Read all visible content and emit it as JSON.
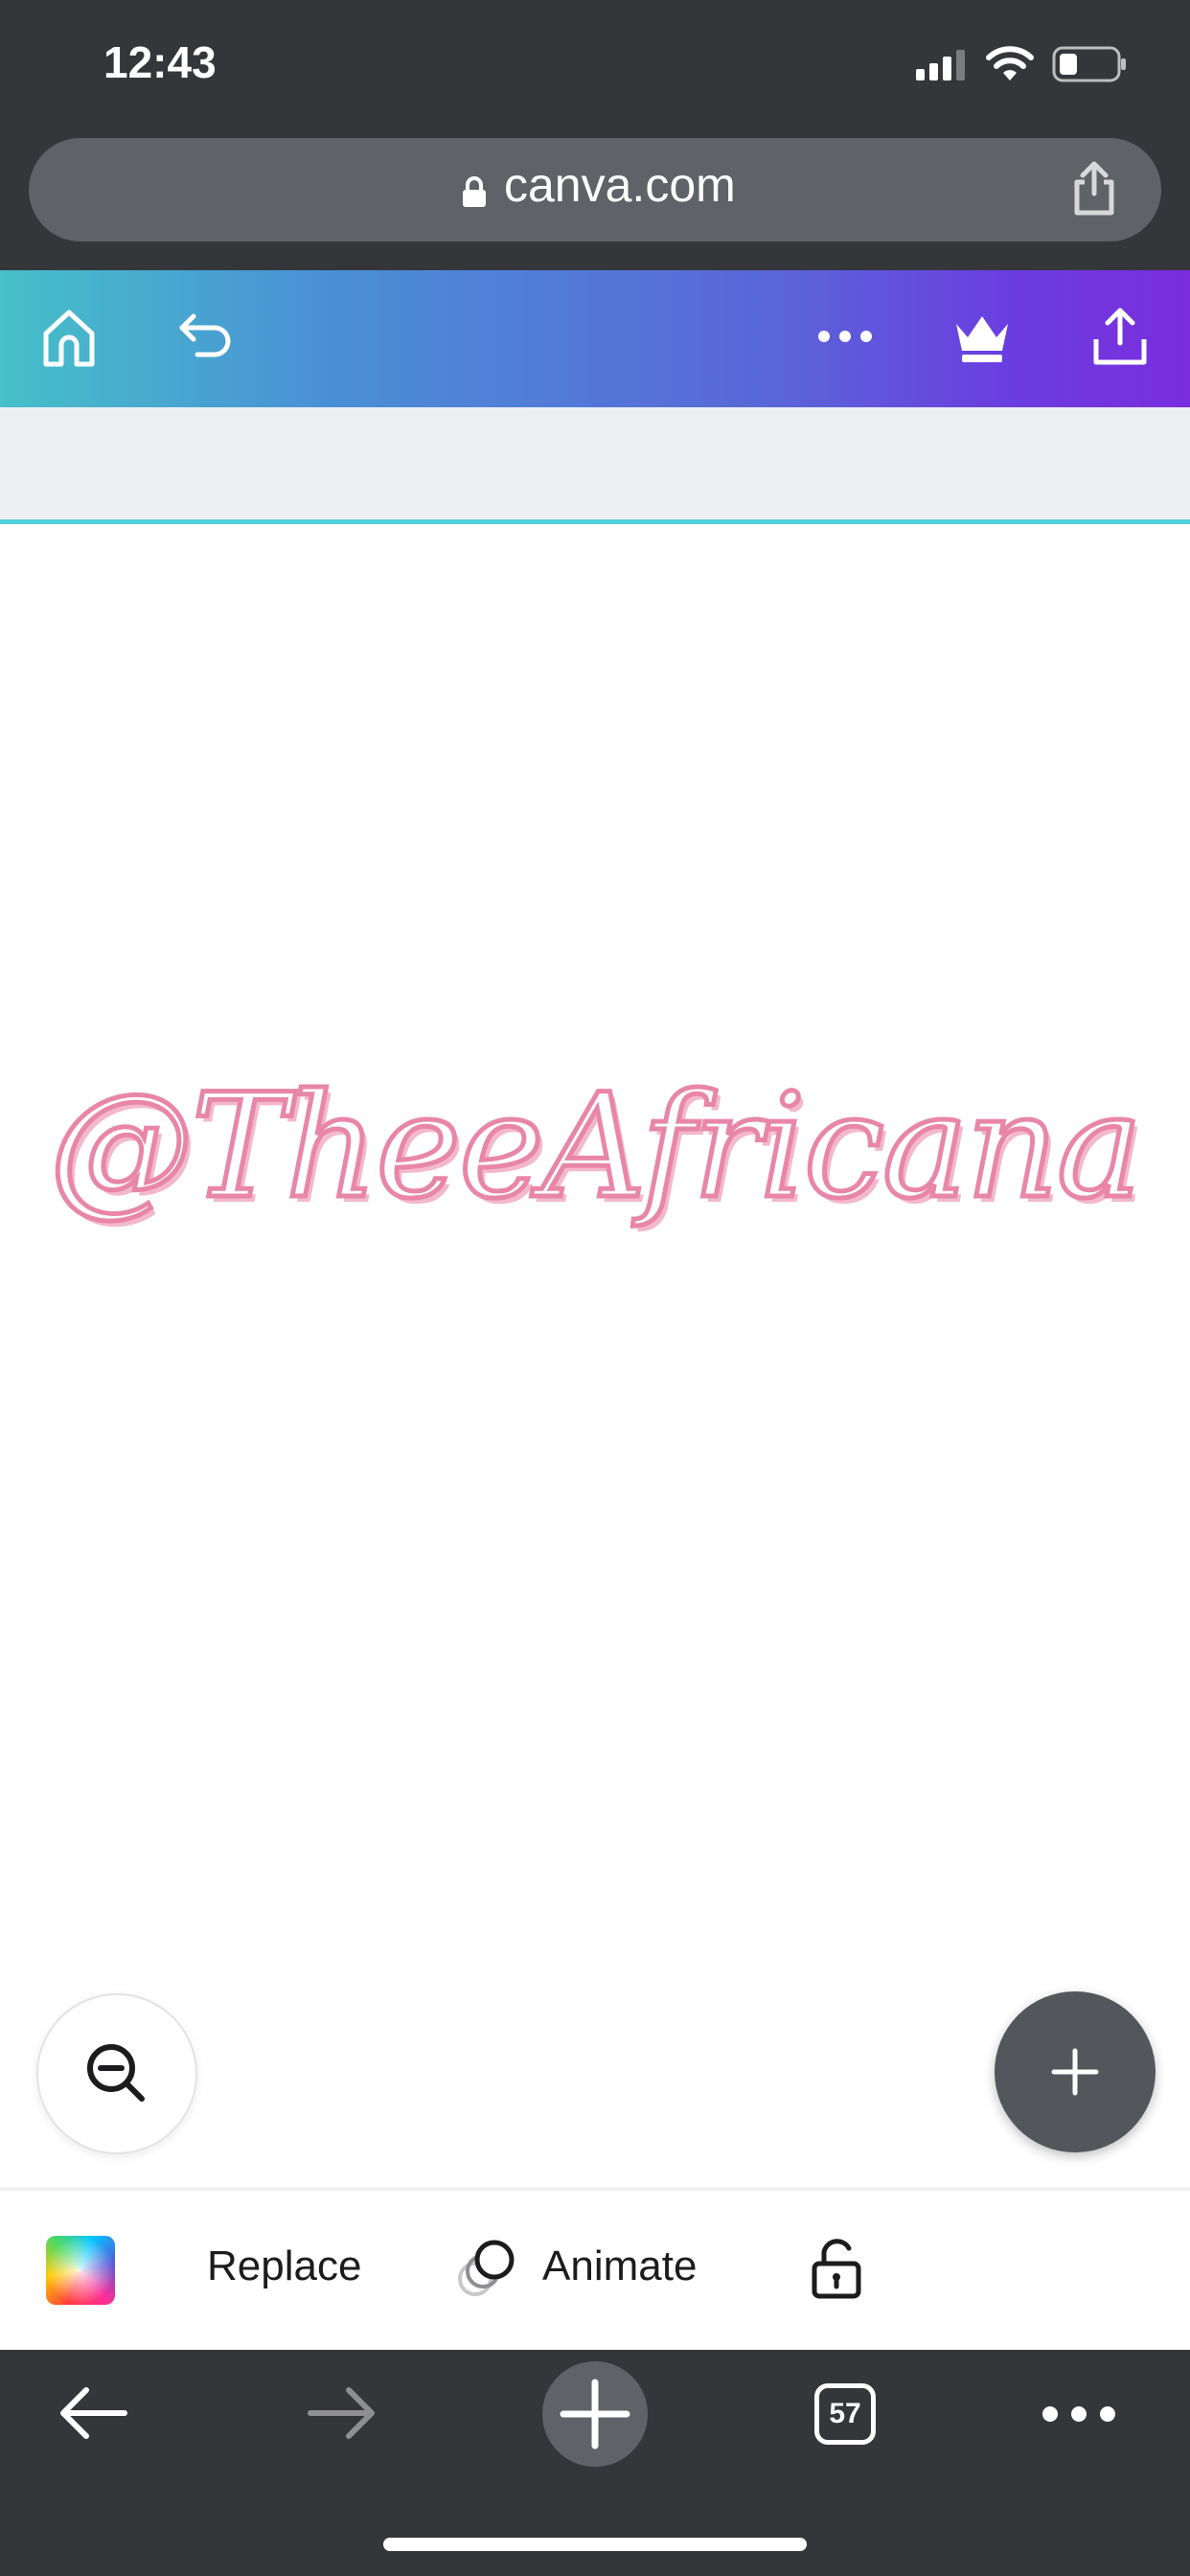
{
  "status_bar": {
    "time": "12:43"
  },
  "browser": {
    "url": "canva.com",
    "tab_count": "57"
  },
  "canvas": {
    "text": "@TheeAfricana",
    "text_color": "#e886a8"
  },
  "toolbar": {
    "gradient_start": "#46c0c9",
    "gradient_end": "#7a2ddd",
    "icons": [
      "home-icon",
      "undo-icon",
      "more-icon",
      "crown-icon",
      "share-icon"
    ]
  },
  "editor_toolbar": {
    "replace_label": "Replace",
    "animate_label": "Animate",
    "icons": [
      "color-swatch",
      "animate-icon",
      "lock-icon"
    ]
  },
  "browser_bottom": {
    "icons": [
      "back-arrow-icon",
      "forward-arrow-icon",
      "new-tab-icon",
      "tabs-icon",
      "more-icon"
    ]
  }
}
